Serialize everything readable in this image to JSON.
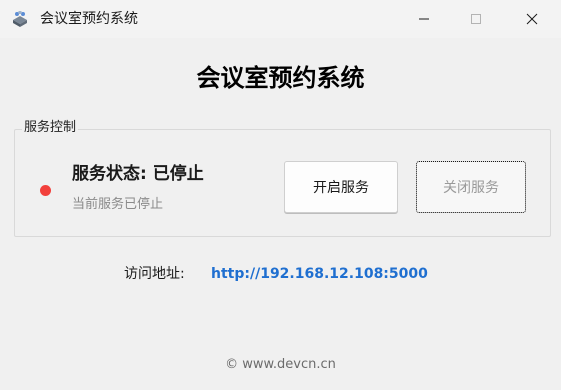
{
  "window": {
    "title": "会议室预约系统",
    "icon": "meeting-app-icon",
    "controls": [
      "minimize-icon",
      "maximize-icon",
      "close-icon"
    ]
  },
  "main": {
    "heading": "会议室预约系统"
  },
  "service_group": {
    "legend": "服务控制",
    "status_label": "服务状态: 已停止",
    "status_detail": "当前服务已停止",
    "status_color": "#f2403c",
    "start_button": "开启服务",
    "stop_button": "关闭服务"
  },
  "access": {
    "label": "访问地址:",
    "url": "http://192.168.12.108:5000",
    "link_color": "#1f6fd0"
  },
  "footer": {
    "text": "© www.devcn.cn"
  }
}
